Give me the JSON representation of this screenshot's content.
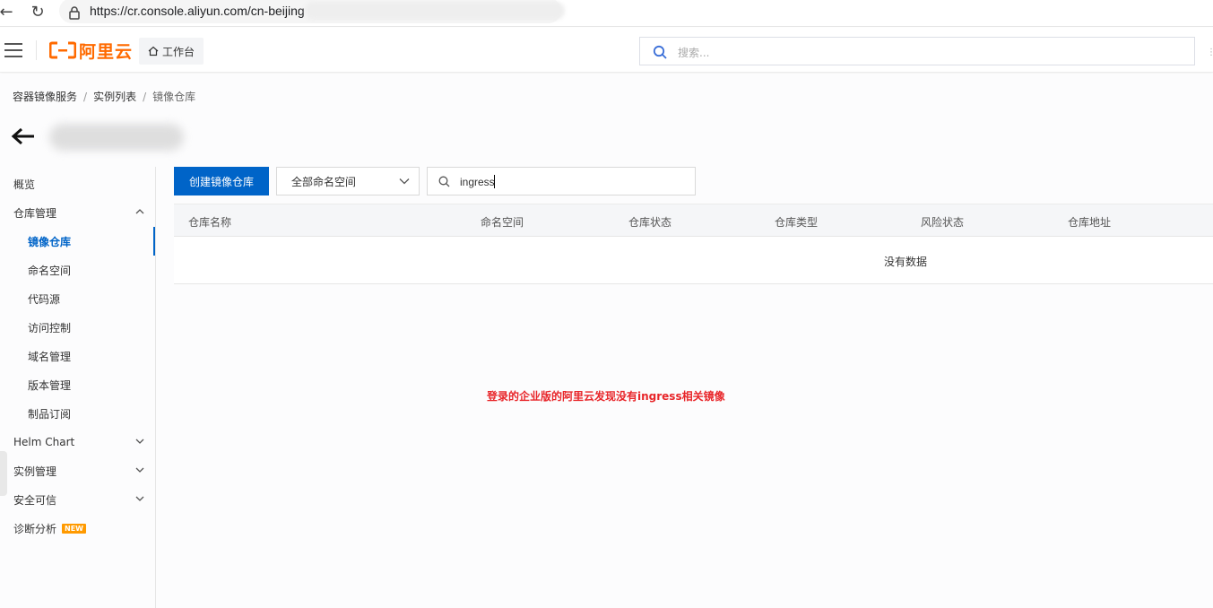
{
  "browser": {
    "url": "https://cr.console.aliyun.com/cn-beijing"
  },
  "header": {
    "logo_text": "阿里云",
    "workbench_label": "工作台",
    "search_placeholder": "搜索..."
  },
  "breadcrumb": {
    "items": [
      "容器镜像服务",
      "实例列表",
      "镜像仓库"
    ],
    "separator": "/"
  },
  "sidebar": {
    "items": [
      {
        "label": "概览"
      },
      {
        "label": "仓库管理"
      },
      {
        "label": "镜像仓库"
      },
      {
        "label": "命名空间"
      },
      {
        "label": "代码源"
      },
      {
        "label": "访问控制"
      },
      {
        "label": "域名管理"
      },
      {
        "label": "版本管理"
      },
      {
        "label": "制品订阅"
      },
      {
        "label": "Helm Chart"
      },
      {
        "label": "实例管理"
      },
      {
        "label": "安全可信"
      },
      {
        "label": "诊断分析",
        "badge": "NEW"
      }
    ]
  },
  "toolbar": {
    "create_label": "创建镜像仓库",
    "namespace_selected": "全部命名空间",
    "search_value": "ingress"
  },
  "table": {
    "columns": [
      "仓库名称",
      "命名空间",
      "仓库状态",
      "仓库类型",
      "风险状态",
      "仓库地址"
    ],
    "empty_text": "没有数据"
  },
  "annotation": "登录的企业版的阿里云发现没有ingress相关镜像",
  "colors": {
    "brand": "#ff6a00",
    "primary": "#0064c8",
    "annotation": "#e8262a",
    "badge": "#ff9a00"
  }
}
